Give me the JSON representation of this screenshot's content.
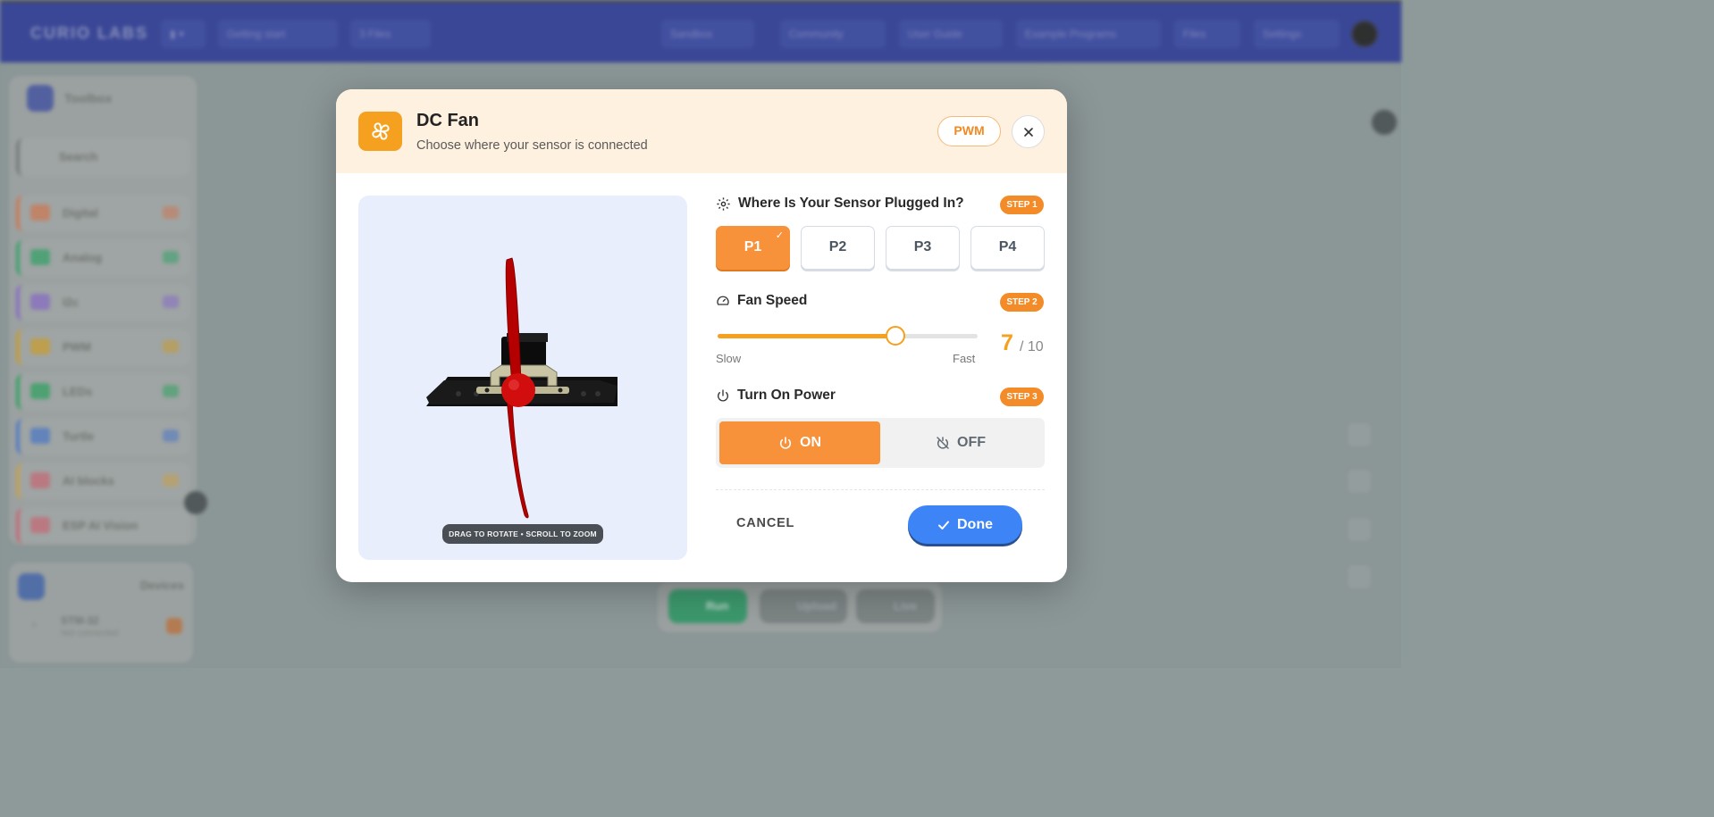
{
  "background": {
    "brand": "CURIO LABS",
    "topbar_items": [
      "Sandbox",
      "Community",
      "User Guide",
      "Example Programs",
      "Files",
      "Settings"
    ],
    "project_name": "Getting start",
    "files_label": "3 Files",
    "toolbox_title": "Toolbox",
    "search_label": "Search",
    "categories": [
      {
        "label": "Digital",
        "color": "#d97a52"
      },
      {
        "label": "Analog",
        "color": "#2fa86a"
      },
      {
        "label": "I2c",
        "color": "#8a6cd0"
      },
      {
        "label": "PWM",
        "color": "#d4a42a"
      },
      {
        "label": "LEDs",
        "color": "#2aa860"
      },
      {
        "label": "Turtle",
        "color": "#4a7ad0"
      },
      {
        "label": "AI blocks",
        "color": "#d6a84a"
      },
      {
        "label": "ESP AI Vision",
        "color": "#d06a78"
      }
    ],
    "devices_title": "Devices",
    "device_name": "STM-32",
    "device_status": "Not connected",
    "run_buttons": [
      "Run",
      "Upload",
      "Live"
    ]
  },
  "modal": {
    "title": "DC Fan",
    "subtitle": "Choose where your sensor is connected",
    "mode_badge": "PWM",
    "close_label": "×",
    "preview_hint": "DRAG TO ROTATE • SCROLL TO ZOOM",
    "step1": {
      "tag": "STEP 1",
      "label": "Where Is Your Sensor Plugged In?",
      "ports": [
        "P1",
        "P2",
        "P3",
        "P4"
      ],
      "selected": "P1"
    },
    "step2": {
      "tag": "STEP 2",
      "label": "Fan Speed",
      "slow_label": "Slow",
      "fast_label": "Fast",
      "value": 7,
      "value_text": "7",
      "max_text": "/ 10",
      "max": 10
    },
    "step3": {
      "tag": "STEP 3",
      "label": "Turn On Power",
      "on_label": "ON",
      "off_label": "OFF",
      "state": "on"
    },
    "cancel_label": "CANCEL",
    "done_label": "Done"
  },
  "colors": {
    "accent_orange": "#f7913a",
    "done_blue": "#3d84f7",
    "topbar_blue": "#2d3b9c"
  }
}
